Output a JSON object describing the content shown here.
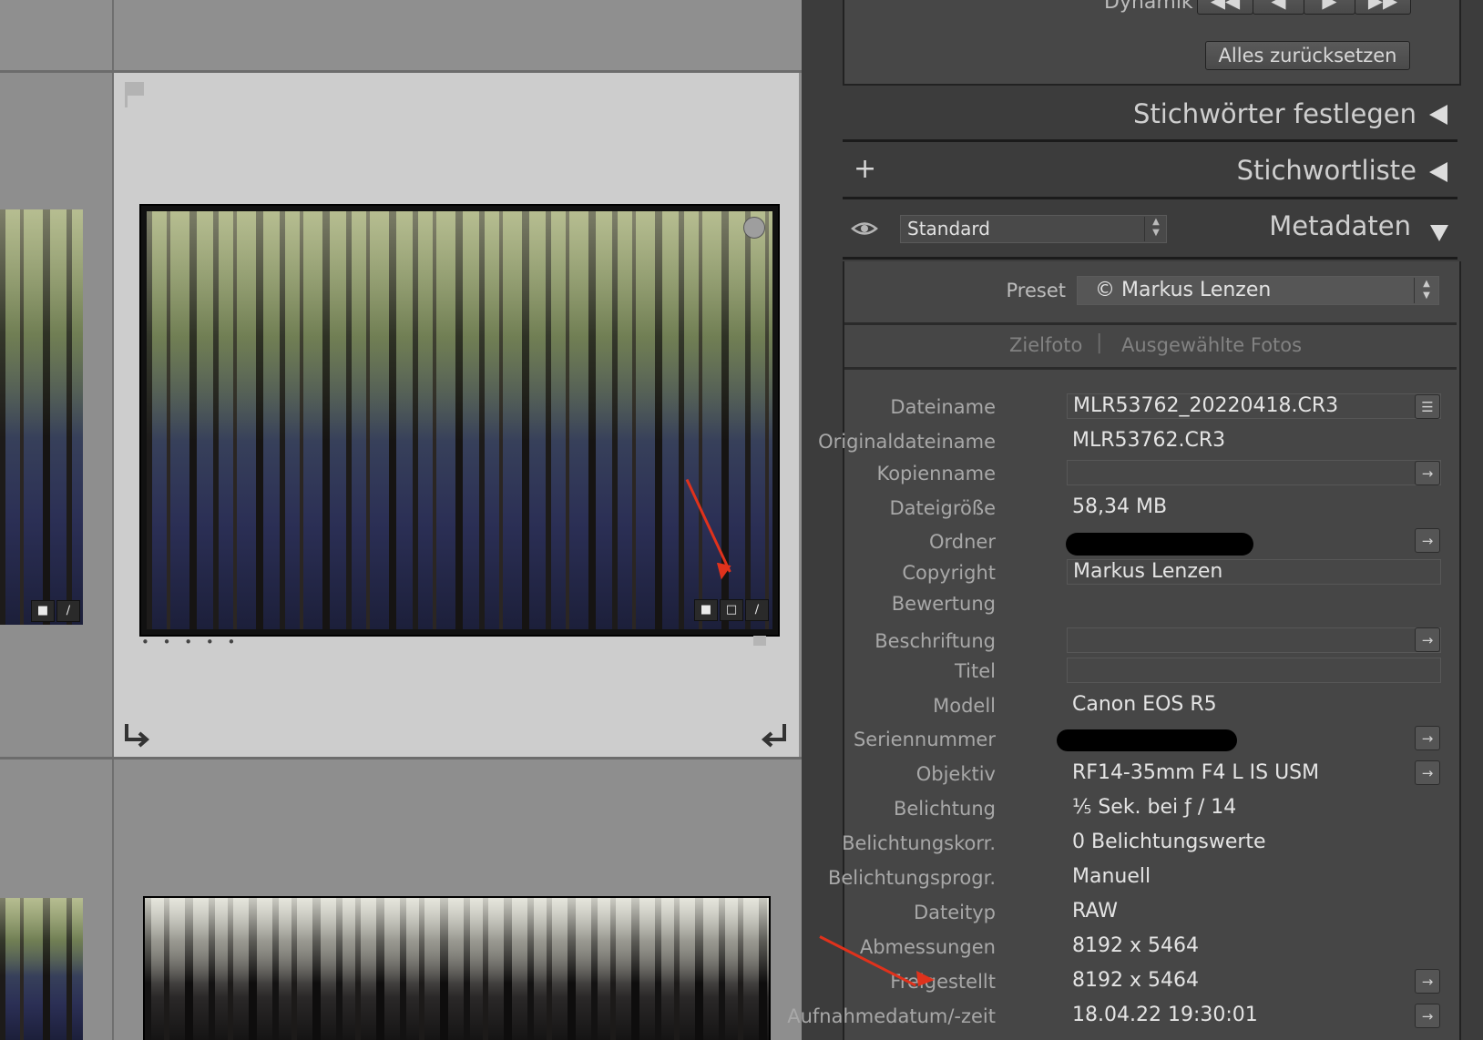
{
  "panel": {
    "dynamik_label": "Dynamik",
    "reset_button": "Alles zurücksetzen",
    "stichwoerter_festlegen": "Stichwörter festlegen",
    "stichwortliste": "Stichwortliste",
    "add_symbol": "+",
    "metadaten": "Metadaten",
    "view_select": "Standard",
    "preset_label": "Preset",
    "preset_value": "© Markus Lenzen",
    "tab_zielfoto": "Zielfoto",
    "tab_ausgewaehlte": "Ausgewählte Fotos",
    "tab_separator": "|"
  },
  "metadata": {
    "dateiname": {
      "label": "Dateiname",
      "value": "MLR53762_20220418.CR3"
    },
    "originaldateiname": {
      "label": "Originaldateiname",
      "value": "MLR53762.CR3"
    },
    "kopienname": {
      "label": "Kopienname",
      "value": ""
    },
    "dateigroesse": {
      "label": "Dateigröße",
      "value": "58,34 MB"
    },
    "ordner": {
      "label": "Ordner",
      "value": ""
    },
    "copyright": {
      "label": "Copyright",
      "value": "Markus Lenzen"
    },
    "bewertung": {
      "label": "Bewertung",
      "value": ""
    },
    "beschriftung": {
      "label": "Beschriftung",
      "value": ""
    },
    "titel": {
      "label": "Titel",
      "value": ""
    },
    "modell": {
      "label": "Modell",
      "value": "Canon EOS R5"
    },
    "seriennummer": {
      "label": "Seriennummer",
      "value": ""
    },
    "objektiv": {
      "label": "Objektiv",
      "value": "RF14-35mm F4 L IS USM"
    },
    "belichtung": {
      "label": "Belichtung",
      "value": "⅕ Sek. bei ƒ / 14"
    },
    "belichtungskorr": {
      "label": "Belichtungskorr.",
      "value": "0 Belichtungswerte"
    },
    "belichtungsprogr": {
      "label": "Belichtungsprogr.",
      "value": "Manuell"
    },
    "dateityp": {
      "label": "Dateityp",
      "value": "RAW"
    },
    "abmessungen": {
      "label": "Abmessungen",
      "value": "8192 x 5464"
    },
    "freigestellt": {
      "label": "Freigestellt",
      "value": "8192 x 5464"
    },
    "aufnahmedatum": {
      "label": "Aufnahmedatum/-zeit",
      "value": "18.04.22 19:30:01"
    }
  },
  "grid": {
    "rating_dots": "• • • • •",
    "icons": [
      "flag-icon",
      "comment-icon",
      "crop-icon",
      "exposure-adjust-icon",
      "rotate-left-icon",
      "rotate-right-icon",
      "eye-icon"
    ]
  },
  "colors": {
    "annotation_arrow": "#e0321c",
    "panel_bg": "#3c3c3c",
    "grid_bg": "#8e8e8e",
    "selected_cell": "#cdcdcd"
  }
}
